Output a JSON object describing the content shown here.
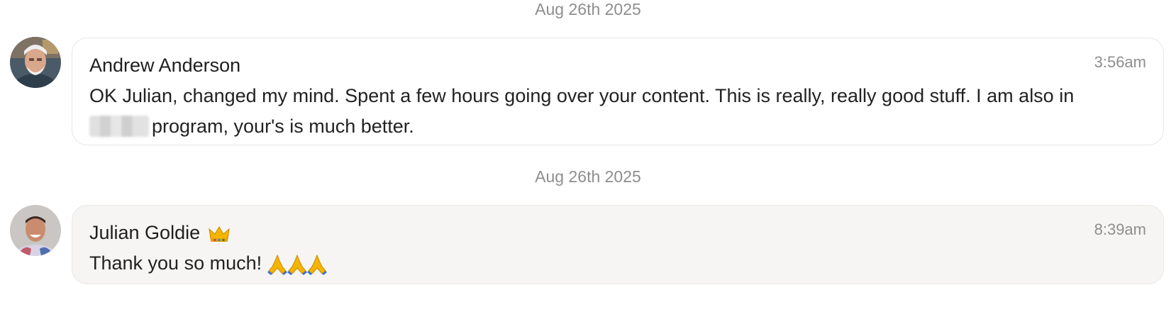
{
  "messages": [
    {
      "date_separator": "Aug 26th 2025",
      "author": "Andrew Anderson",
      "time": "3:56am",
      "text_part1": "OK Julian, changed my mind. Spent a few hours going over your content. This is really, really good stuff. I am also in",
      "text_part2": "program, your's is much better.",
      "avatar_icon": "older-man-avatar"
    },
    {
      "date_separator": "Aug 26th 2025",
      "author": "Julian Goldie",
      "author_badge_icon": "crown-icon",
      "time": "8:39am",
      "text": "Thank you so much!",
      "reaction_icons": [
        "folded-hands-icon",
        "folded-hands-icon",
        "folded-hands-icon"
      ],
      "avatar_icon": "young-man-avatar"
    }
  ],
  "colors": {
    "bubble_grey": "#f6f5f3",
    "muted_text": "#8e8e8e",
    "border": "#e6e6e6"
  }
}
